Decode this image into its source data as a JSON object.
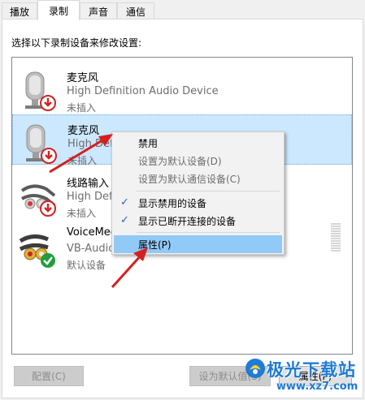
{
  "tabs": [
    {
      "label": "播放"
    },
    {
      "label": "录制"
    },
    {
      "label": "声音"
    },
    {
      "label": "通信"
    }
  ],
  "instruction": "选择以下录制设备来修改设置:",
  "devices": [
    {
      "name": "麦克风",
      "desc": "High Definition Audio Device",
      "status": "未插入",
      "icon": "microphone-icon",
      "badge": "disconnected-badge-icon"
    },
    {
      "name": "麦克风",
      "desc": "High Definiti",
      "status": "未插入",
      "icon": "microphone-icon",
      "badge": "disconnected-badge-icon"
    },
    {
      "name": "线路输入",
      "desc": "High Defini",
      "status": "未插入",
      "icon": "line-in-cable-icon",
      "badge": "disconnected-badge-icon"
    },
    {
      "name": "VoiceMee",
      "desc": "VB-Audio",
      "status": "默认设备",
      "icon": "rca-cable-icon",
      "badge": "default-check-badge-icon"
    }
  ],
  "context_menu": {
    "items": [
      {
        "label": "禁用",
        "checked": false,
        "disabled": false
      },
      {
        "label": "设置为默认设备(D)",
        "checked": false,
        "disabled": true
      },
      {
        "label": "设置为默认通信设备(C)",
        "checked": false,
        "disabled": true
      },
      {
        "label": "显示禁用的设备",
        "checked": true,
        "disabled": false
      },
      {
        "label": "显示已断开连接的设备",
        "checked": true,
        "disabled": false
      },
      {
        "label": "属性(P)",
        "checked": false,
        "disabled": false,
        "highlighted": true
      }
    ]
  },
  "buttons": {
    "configure": "配置(C)",
    "set_default": "设为默认值(S)",
    "properties": "属性(P)"
  },
  "watermark": {
    "title": "极光下载站",
    "url": "www.xz7.com"
  },
  "colors": {
    "selection": "#cce8ff",
    "menu_hover": "#91c9f7",
    "arrow": "#d61f1f",
    "disconnected_badge": "#d32222",
    "default_badge": "#1f9e3c",
    "watermark": "#1e7bd6"
  }
}
